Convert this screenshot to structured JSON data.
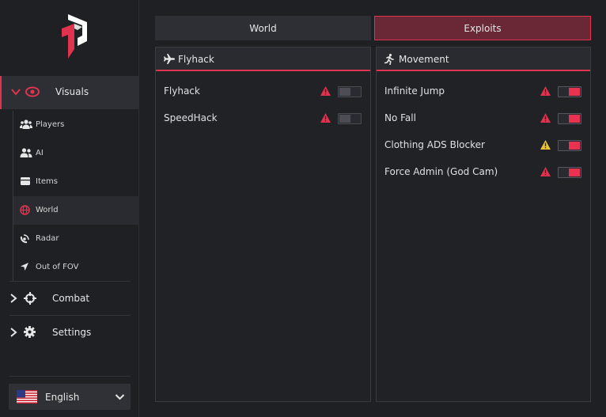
{
  "colors": {
    "accent": "#e0334f",
    "warn_red": "#e0334f",
    "warn_yellow": "#e8c33a",
    "bg": "#1f2024"
  },
  "sidebar": {
    "visuals": {
      "label": "Visuals",
      "icon": "eye-icon"
    },
    "sub_items": [
      {
        "label": "Players",
        "icon": "users-icon"
      },
      {
        "label": "AI",
        "icon": "user-group-icon"
      },
      {
        "label": "Items",
        "icon": "box-icon"
      },
      {
        "label": "World",
        "icon": "globe-icon"
      },
      {
        "label": "Radar",
        "icon": "radar-icon"
      },
      {
        "label": "Out of FOV",
        "icon": "location-arrow-icon"
      }
    ],
    "combat": {
      "label": "Combat",
      "icon": "crosshair-icon"
    },
    "settings": {
      "label": "Settings",
      "icon": "gear-icon"
    },
    "language": {
      "label": "English",
      "icon": "us-flag-icon"
    }
  },
  "tabs": {
    "world": "World",
    "exploits": "Exploits"
  },
  "panels": {
    "left": {
      "title": "Flyhack",
      "icon": "plane-icon",
      "rows": [
        {
          "label": "Flyhack",
          "warn": "red",
          "enabled": false
        },
        {
          "label": "SpeedHack",
          "warn": "red",
          "enabled": false
        }
      ]
    },
    "right": {
      "title": "Movement",
      "icon": "running-icon",
      "rows": [
        {
          "label": "Infinite Jump",
          "warn": "red",
          "enabled": true
        },
        {
          "label": "No Fall",
          "warn": "red",
          "enabled": true
        },
        {
          "label": "Clothing ADS Blocker",
          "warn": "yellow",
          "enabled": true
        },
        {
          "label": "Force Admin (God Cam)",
          "warn": "red",
          "enabled": true
        }
      ]
    }
  }
}
